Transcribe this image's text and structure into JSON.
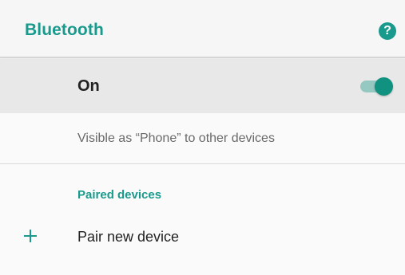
{
  "appbar": {
    "title": "Bluetooth",
    "help_icon": "help-circle-icon",
    "help_glyph": "?"
  },
  "main_switch": {
    "label": "On",
    "state": "on",
    "accent_color": "#11917f"
  },
  "visibility": {
    "text": "Visible as “Phone” to other devices"
  },
  "paired_devices": {
    "header": "Paired devices",
    "pair_new": {
      "label": "Pair new device",
      "icon": "plus-icon"
    }
  },
  "colors": {
    "accent": "#1a9a8c",
    "background": "#fafafa",
    "switch_bar_background": "#e8e8e8"
  }
}
